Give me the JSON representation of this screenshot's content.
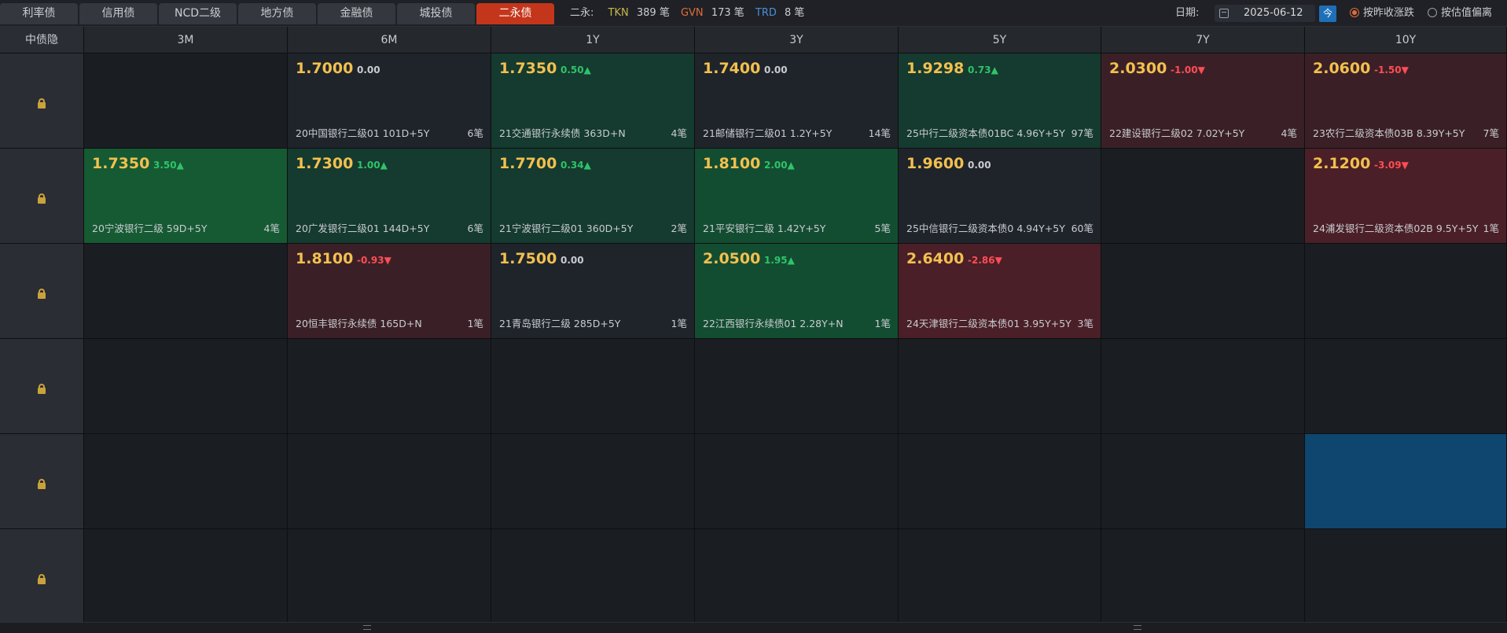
{
  "tabs": [
    {
      "label": "利率债",
      "active": false
    },
    {
      "label": "信用债",
      "active": false
    },
    {
      "label": "NCD二级",
      "active": false
    },
    {
      "label": "地方债",
      "active": false
    },
    {
      "label": "金融债",
      "active": false
    },
    {
      "label": "城投债",
      "active": false
    },
    {
      "label": "二永债",
      "active": true
    }
  ],
  "stats": {
    "label": "二永:",
    "tkn_label": "TKN",
    "tkn_value": "389 笔",
    "gvn_label": "GVN",
    "gvn_value": "173 笔",
    "trd_label": "TRD",
    "trd_value": "8 笔"
  },
  "date": {
    "label": "日期:",
    "value": "2025-06-12",
    "today_label": "今"
  },
  "radios": [
    {
      "label": "按昨收涨跌",
      "selected": true
    },
    {
      "label": "按估值偏离",
      "selected": false
    }
  ],
  "grid": {
    "corner_label": "中债隐",
    "columns": [
      "3M",
      "6M",
      "1Y",
      "3Y",
      "5Y",
      "7Y",
      "10Y"
    ],
    "rows": [
      [
        null,
        {
          "price": "1.7000",
          "change": "0.00",
          "dir": "flat",
          "name": "20中国银行二级01 101D+5Y",
          "count": "6笔",
          "tone": "neutral"
        },
        {
          "price": "1.7350",
          "change": "0.50▲",
          "dir": "up",
          "name": "21交通银行永续债 363D+N",
          "count": "4笔",
          "tone": "green1"
        },
        {
          "price": "1.7400",
          "change": "0.00",
          "dir": "flat",
          "name": "21邮储银行二级01 1.2Y+5Y",
          "count": "14笔",
          "tone": "neutral"
        },
        {
          "price": "1.9298",
          "change": "0.73▲",
          "dir": "up",
          "name": "25中行二级资本债01BC 4.96Y+5Y",
          "count": "97笔",
          "tone": "green1"
        },
        {
          "price": "2.0300",
          "change": "-1.00▼",
          "dir": "down",
          "name": "22建设银行二级02 7.02Y+5Y",
          "count": "4笔",
          "tone": "red1"
        },
        {
          "price": "2.0600",
          "change": "-1.50▼",
          "dir": "down",
          "name": "23农行二级资本债03B 8.39Y+5Y",
          "count": "7笔",
          "tone": "red1"
        }
      ],
      [
        {
          "price": "1.7350",
          "change": "3.50▲",
          "dir": "up",
          "name": "20宁波银行二级 59D+5Y",
          "count": "4笔",
          "tone": "green3"
        },
        {
          "price": "1.7300",
          "change": "1.00▲",
          "dir": "up",
          "name": "20广发银行二级01 144D+5Y",
          "count": "6笔",
          "tone": "green1"
        },
        {
          "price": "1.7700",
          "change": "0.34▲",
          "dir": "up",
          "name": "21宁波银行二级01 360D+5Y",
          "count": "2笔",
          "tone": "green1"
        },
        {
          "price": "1.8100",
          "change": "2.00▲",
          "dir": "up",
          "name": "21平安银行二级 1.42Y+5Y",
          "count": "5笔",
          "tone": "green2"
        },
        {
          "price": "1.9600",
          "change": "0.00",
          "dir": "flat",
          "name": "25中信银行二级资本债0 4.94Y+5Y",
          "count": "60笔",
          "tone": "neutral"
        },
        null,
        {
          "price": "2.1200",
          "change": "-3.09▼",
          "dir": "down",
          "name": "24浦发银行二级资本债02B 9.5Y+5Y",
          "count": "1笔",
          "tone": "red2"
        }
      ],
      [
        null,
        {
          "price": "1.8100",
          "change": "-0.93▼",
          "dir": "down",
          "name": "20恒丰银行永续债 165D+N",
          "count": "1笔",
          "tone": "red1"
        },
        {
          "price": "1.7500",
          "change": "0.00",
          "dir": "flat",
          "name": "21青岛银行二级 285D+5Y",
          "count": "1笔",
          "tone": "neutral"
        },
        {
          "price": "2.0500",
          "change": "1.95▲",
          "dir": "up",
          "name": "22江西银行永续债01 2.28Y+N",
          "count": "1笔",
          "tone": "green2"
        },
        {
          "price": "2.6400",
          "change": "-2.86▼",
          "dir": "down",
          "name": "24天津银行二级资本债01 3.95Y+5Y",
          "count": "3笔",
          "tone": "red2"
        },
        null,
        null
      ],
      [
        null,
        null,
        null,
        null,
        null,
        null,
        null
      ],
      [
        null,
        null,
        null,
        null,
        null,
        null,
        {
          "empty_tone": "blue"
        }
      ],
      [
        null,
        null,
        null,
        null,
        null,
        null,
        null
      ]
    ]
  }
}
